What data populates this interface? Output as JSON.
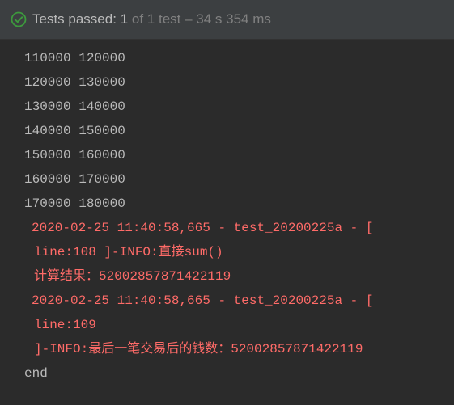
{
  "status": {
    "icon": "check-circle-icon",
    "label": "Tests passed:",
    "count": "1",
    "of_text": "of 1 test",
    "duration": "– 34 s 354 ms",
    "color_success": "#3d9a3d"
  },
  "console": {
    "lines": [
      {
        "text": "110000 120000",
        "type": "out"
      },
      {
        "text": "120000 130000",
        "type": "out"
      },
      {
        "text": "130000 140000",
        "type": "out"
      },
      {
        "text": "140000 150000",
        "type": "out"
      },
      {
        "text": "150000 160000",
        "type": "out"
      },
      {
        "text": "160000 170000",
        "type": "out"
      },
      {
        "text": "170000 180000",
        "type": "out"
      },
      {
        "text": "2020-02-25 11:40:58,665 - test_20200225a - [",
        "type": "err"
      },
      {
        "text": "line:108 ]-INFO:直接sum()",
        "type": "err"
      },
      {
        "text": "计算结果：52002857871422119",
        "type": "err"
      },
      {
        "text": "2020-02-25 11:40:58,665 - test_20200225a - [",
        "type": "err"
      },
      {
        "text": "line:109",
        "type": "err"
      },
      {
        "text": "]-INFO:最后一笔交易后的钱数：52002857871422119",
        "type": "err"
      },
      {
        "text": "end",
        "type": "out"
      }
    ],
    "color_out": "#bbbbbb",
    "color_err": "#ff6b68"
  }
}
